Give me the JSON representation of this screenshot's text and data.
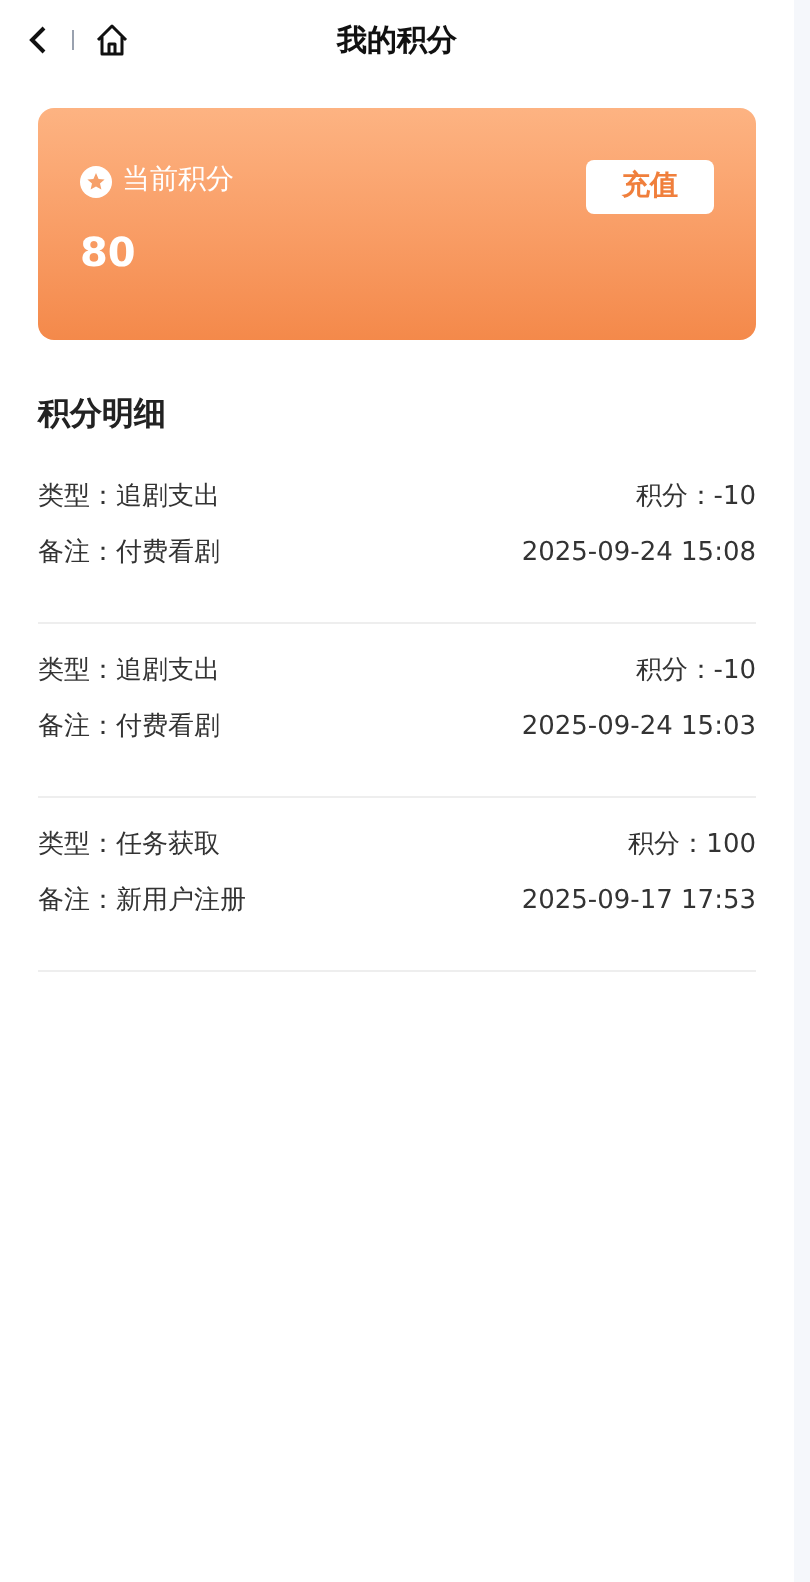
{
  "header": {
    "title": "我的积分"
  },
  "points_card": {
    "label": "当前积分",
    "value": "80",
    "button": "充值"
  },
  "section_title": "积分明细",
  "records": [
    {
      "type": "类型：追剧支出",
      "points": "积分：-10",
      "note": "备注：付费看剧",
      "time": "2025-09-24 15:08"
    },
    {
      "type": "类型：追剧支出",
      "points": "积分：-10",
      "note": "备注：付费看剧",
      "time": "2025-09-24 15:03"
    },
    {
      "type": "类型：任务获取",
      "points": "积分：100",
      "note": "备注：新用户注册",
      "time": "2025-09-17 17:53"
    }
  ]
}
